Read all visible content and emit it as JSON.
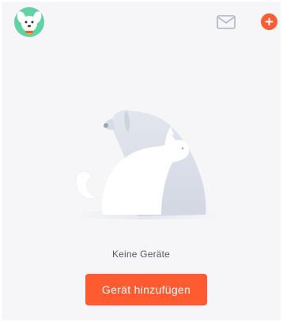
{
  "header": {
    "avatar_icon": "dog-avatar-icon",
    "mail_icon": "mail-icon",
    "add_icon": "plus-circle-icon"
  },
  "empty_state": {
    "illustration_icon": "dog-and-cat-illustration",
    "message": "Keine Geräte",
    "button_label": "Gerät hinzufügen"
  },
  "colors": {
    "accent": "#ff5b31",
    "background": "#f6f6f8",
    "avatar_bg": "#5fd3a3",
    "icon_gray": "#aeb4c2",
    "text_secondary": "#555a61"
  }
}
